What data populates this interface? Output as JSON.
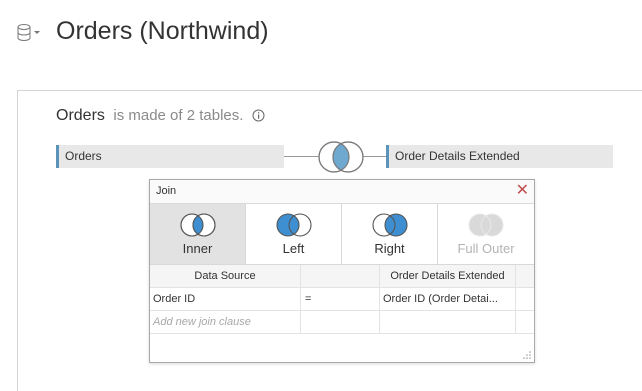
{
  "header": {
    "title": "Orders (Northwind)",
    "datasource_icon": "database-icon",
    "dropdown_icon": "caret-down-icon"
  },
  "canvas": {
    "summary": {
      "table_name": "Orders",
      "made_of": "is made of 2 tables.",
      "info_icon": "info-icon"
    },
    "left_table": "Orders",
    "right_table": "Order Details Extended",
    "join_icon": "inner-join-icon"
  },
  "join_dialog": {
    "title": "Join",
    "close_icon": "close-icon",
    "join_types": [
      {
        "label": "Inner",
        "icon": "inner-join-icon",
        "selected": true,
        "enabled": true
      },
      {
        "label": "Left",
        "icon": "left-join-icon",
        "selected": false,
        "enabled": true
      },
      {
        "label": "Right",
        "icon": "right-join-icon",
        "selected": false,
        "enabled": true
      },
      {
        "label": "Full Outer",
        "icon": "full-outer-join-icon",
        "selected": false,
        "enabled": false
      }
    ],
    "columns": [
      "Data Source",
      "",
      "Order Details Extended"
    ],
    "clauses": [
      {
        "left": "Order ID",
        "op": "=",
        "right": "Order ID (Order Detai..."
      }
    ],
    "add_clause_placeholder": "Add new join clause"
  },
  "colors": {
    "accent_blue": "#5c93b8",
    "join_fill": "#3d8fd1",
    "close_red": "#c0504d",
    "selected_bg": "#e2e2e2"
  }
}
